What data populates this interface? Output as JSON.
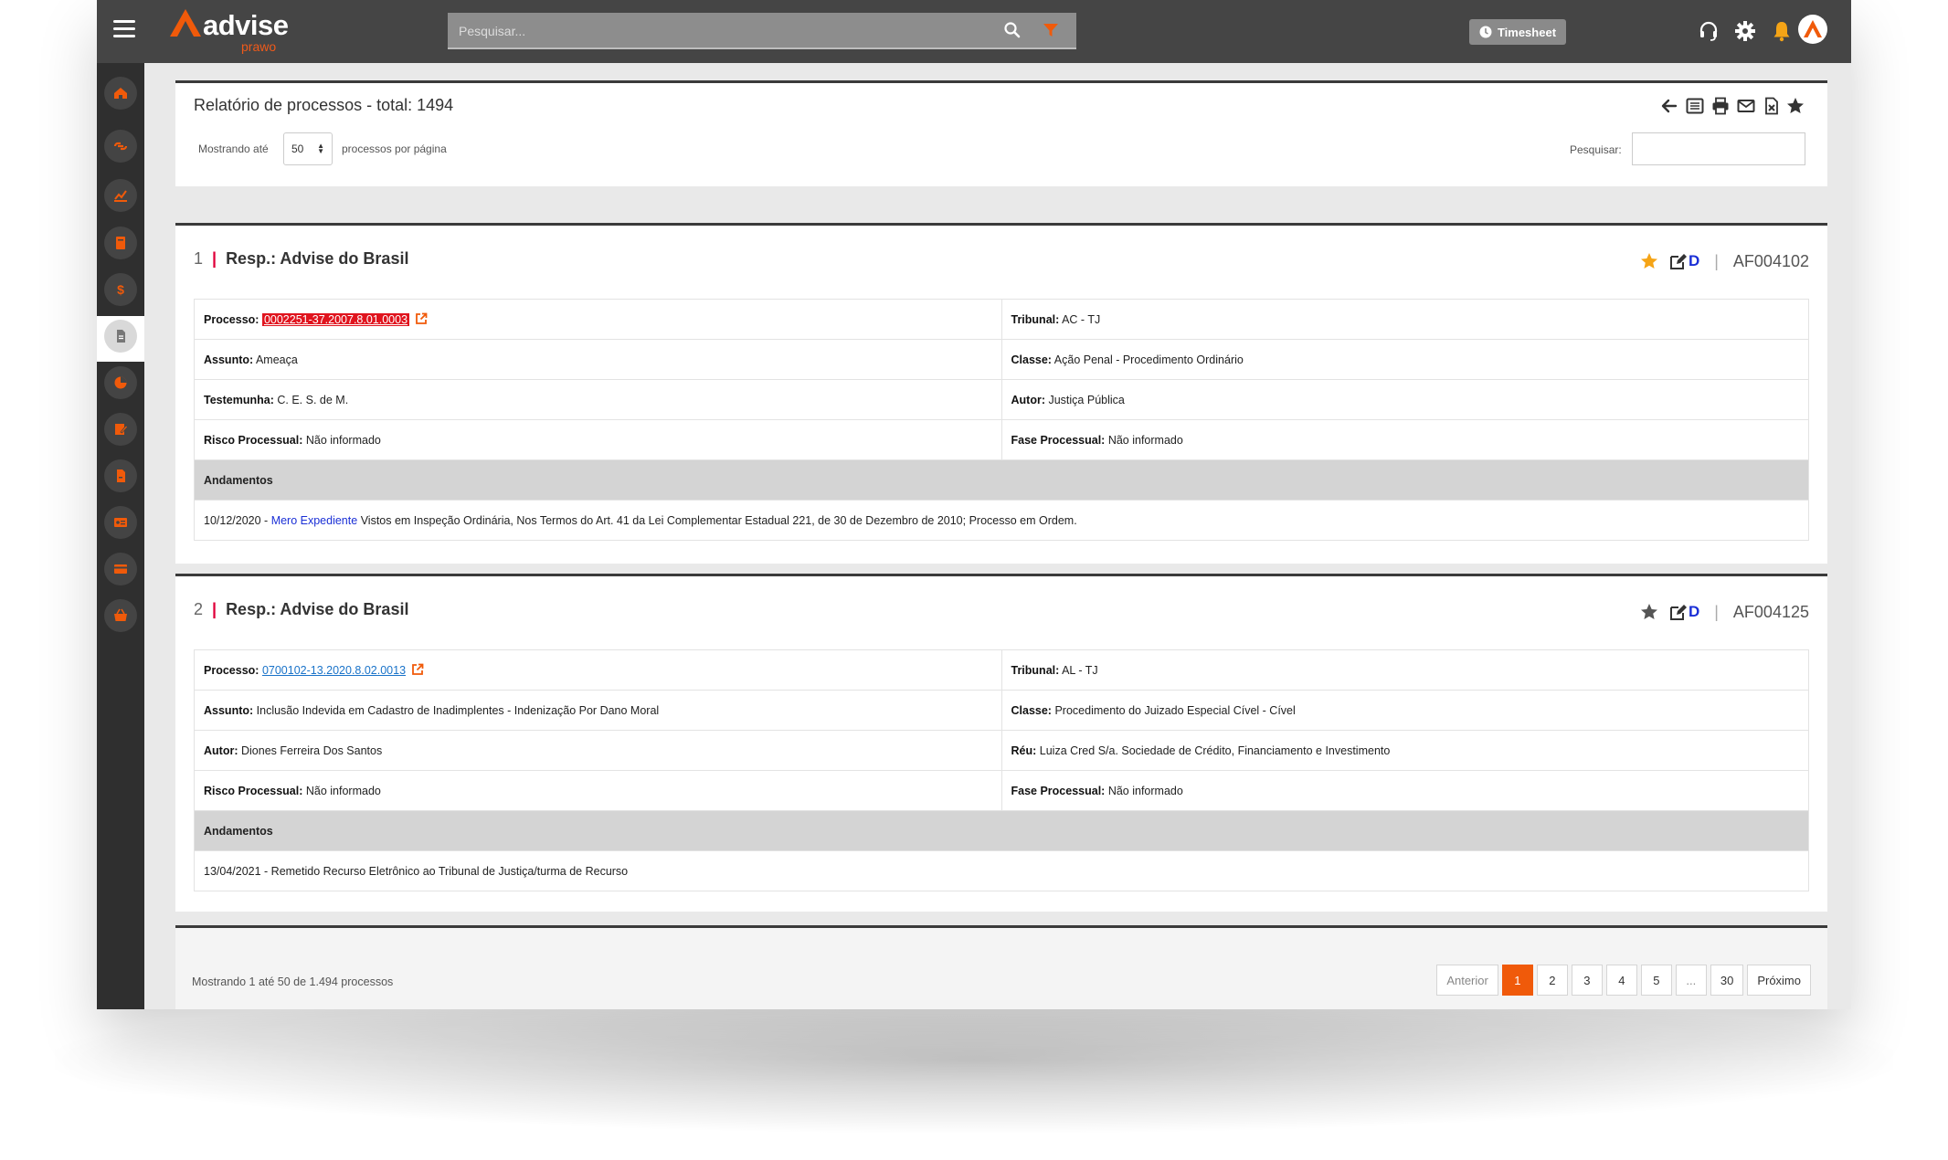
{
  "app": {
    "brand": "advise",
    "brand_sub": "prawo",
    "search_placeholder": "Pesquisar...",
    "timesheet_label": "Timesheet",
    "accent_color": "#f05a0a"
  },
  "sidebar": {
    "items": [
      {
        "icon": "home-icon"
      },
      {
        "icon": "link-icon"
      },
      {
        "icon": "chart-icon"
      },
      {
        "icon": "book-icon"
      },
      {
        "icon": "dollar-icon"
      },
      {
        "icon": "document-icon",
        "active": true
      },
      {
        "icon": "pie-chart-icon"
      },
      {
        "icon": "edit-document-icon"
      },
      {
        "icon": "file-icon"
      },
      {
        "icon": "id-card-icon"
      },
      {
        "icon": "credit-card-icon"
      },
      {
        "icon": "basket-icon"
      }
    ]
  },
  "report": {
    "title": "Relatório de processos - total: 1494",
    "show_prefix": "Mostrando até",
    "page_size": "50",
    "show_suffix": "processos por página",
    "search_label": "Pesquisar:",
    "search_value": ""
  },
  "processes": [
    {
      "index": "1",
      "resp": "Resp.: Advise do Brasil",
      "code": "AF004102",
      "d_label": "D",
      "starred": true,
      "rows": [
        {
          "l_label": "Processo:",
          "l_value": "0002251-37.2007.8.01.0003",
          "r_label": "Tribunal:",
          "r_value": "AC - TJ"
        },
        {
          "l_label": "Assunto:",
          "l_value": "Ameaça",
          "r_label": "Classe:",
          "r_value": "Ação Penal - Procedimento Ordinário"
        },
        {
          "l_label": "Testemunha:",
          "l_value": "C. E. S. de M.",
          "r_label": "Autor:",
          "r_value": "Justiça Pública"
        },
        {
          "l_label": "Risco Processual:",
          "l_value": "Não informado",
          "r_label": "Fase Processual:",
          "r_value": "Não informado"
        }
      ],
      "andamentos_label": "Andamentos",
      "andamento_date": "10/12/2020 -",
      "andamento_link": "Mero Expediente",
      "andamento_text": "Vistos em Inspeção Ordinária, Nos Termos do Art. 41 da Lei Complementar Estadual 221, de 30 de Dezembro de 2010; Processo em Ordem."
    },
    {
      "index": "2",
      "resp": "Resp.: Advise do Brasil",
      "code": "AF004125",
      "d_label": "D",
      "starred": false,
      "rows": [
        {
          "l_label": "Processo:",
          "l_value": "0700102-13.2020.8.02.0013",
          "r_label": "Tribunal:",
          "r_value": "AL - TJ"
        },
        {
          "l_label": "Assunto:",
          "l_value": "Inclusão Indevida em Cadastro de Inadimplentes - Indenização Por Dano Moral",
          "r_label": "Classe:",
          "r_value": "Procedimento do Juizado Especial Cível - Cível"
        },
        {
          "l_label": "Autor:",
          "l_value": "Diones Ferreira Dos Santos",
          "r_label": "Réu:",
          "r_value": "Luiza Cred S/a. Sociedade de Crédito, Financiamento e Investimento"
        },
        {
          "l_label": "Risco Processual:",
          "l_value": "Não informado",
          "r_label": "Fase Processual:",
          "r_value": "Não informado"
        }
      ],
      "andamentos_label": "Andamentos",
      "andamento_text": "13/04/2021 - Remetido Recurso Eletrônico ao Tribunal de Justiça/turma de Recurso"
    }
  ],
  "pagination": {
    "info": "Mostrando 1 até 50 de 1.494 processos",
    "prev": "Anterior",
    "pages": [
      "1",
      "2",
      "3",
      "4",
      "5",
      "...",
      "30"
    ],
    "current": "1",
    "next": "Próximo"
  }
}
